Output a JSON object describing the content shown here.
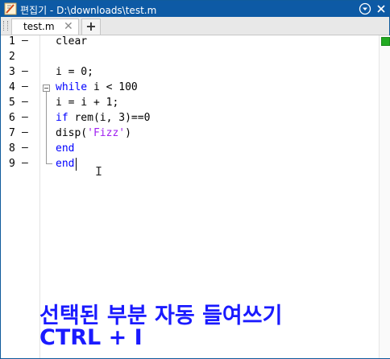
{
  "window": {
    "title": "편집기 - D:\\downloads\\test.m",
    "menu_icon": "chevron-down-circle-icon",
    "close_icon": "close-icon"
  },
  "tabs": [
    {
      "label": "test.m",
      "close": "✕"
    }
  ],
  "add_tab_label": "+",
  "lines": [
    {
      "n": "1",
      "dash": "–",
      "text": "clear"
    },
    {
      "n": "2",
      "dash": "",
      "text": ""
    },
    {
      "n": "3",
      "dash": "–",
      "text": "i = 0;"
    },
    {
      "n": "4",
      "dash": "–",
      "kw": "while",
      "rest": " i < 100"
    },
    {
      "n": "5",
      "dash": "–",
      "text": "i = i + 1;"
    },
    {
      "n": "6",
      "dash": "–",
      "kw": "if",
      "rest": " rem(i, 3)==0"
    },
    {
      "n": "7",
      "dash": "–",
      "pre": "disp(",
      "str": "'Fizz'",
      "post": ")"
    },
    {
      "n": "8",
      "dash": "–",
      "kw": "end",
      "rest": ""
    },
    {
      "n": "9",
      "dash": "–",
      "kw": "end",
      "rest": ""
    }
  ],
  "caption": {
    "line1": "선택된 부분 자동 들여쓰기",
    "line2": "CTRL + I"
  },
  "colors": {
    "titlebar": "#0d5aa5",
    "keyword": "#0000ff",
    "string": "#a020f0",
    "caption": "#1a1aff",
    "status_ok": "#22aa22"
  }
}
